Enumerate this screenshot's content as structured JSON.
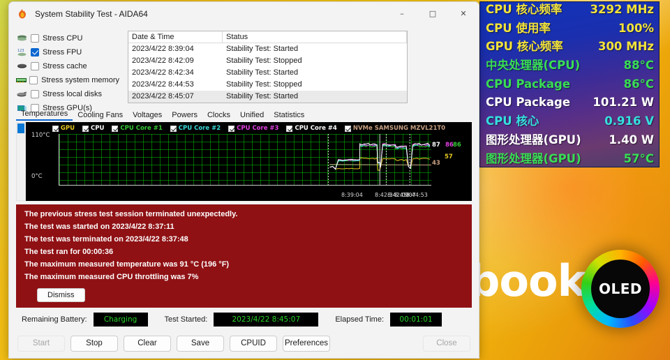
{
  "window": {
    "title": "System Stability Test - AIDA64",
    "app_icon": "flame-icon",
    "minimize": "–",
    "maximize": "□",
    "close": "✕"
  },
  "stress_options": [
    {
      "label": "Stress CPU",
      "checked": false,
      "icon": "cpu-chip-icon"
    },
    {
      "label": "Stress FPU",
      "checked": true,
      "icon": "fpu-chip-icon"
    },
    {
      "label": "Stress cache",
      "checked": false,
      "icon": "cache-chip-icon"
    },
    {
      "label": "Stress system memory",
      "checked": false,
      "icon": "memory-module-icon"
    },
    {
      "label": "Stress local disks",
      "checked": false,
      "icon": "hard-disk-icon"
    },
    {
      "label": "Stress GPU(s)",
      "checked": false,
      "icon": "gpu-card-icon"
    }
  ],
  "log": {
    "columns": [
      "Date & Time",
      "Status"
    ],
    "rows": [
      {
        "datetime": "2023/4/22 8:39:04",
        "status": "Stability Test: Started"
      },
      {
        "datetime": "2023/4/22 8:42:09",
        "status": "Stability Test: Stopped"
      },
      {
        "datetime": "2023/4/22 8:42:34",
        "status": "Stability Test: Started"
      },
      {
        "datetime": "2023/4/22 8:44:53",
        "status": "Stability Test: Stopped"
      },
      {
        "datetime": "2023/4/22 8:45:07",
        "status": "Stability Test: Started"
      }
    ]
  },
  "tabs": [
    {
      "label": "Temperatures",
      "active": true
    },
    {
      "label": "Cooling Fans",
      "active": false
    },
    {
      "label": "Voltages",
      "active": false
    },
    {
      "label": "Powers",
      "active": false
    },
    {
      "label": "Clocks",
      "active": false
    },
    {
      "label": "Unified",
      "active": false
    },
    {
      "label": "Statistics",
      "active": false
    }
  ],
  "chart_data": {
    "type": "line",
    "title": "Temperatures",
    "xlabel": "",
    "ylabel": "°C",
    "ylim": [
      0,
      110
    ],
    "ytick_labels": [
      "110°C",
      "0°C"
    ],
    "grid": true,
    "legend_position": "top",
    "x_tick_labels": [
      "8:39:04",
      "8:42:34",
      "8:42:09",
      "8:45:07",
      "8:44:53"
    ],
    "series": [
      {
        "name": "GPU",
        "color": "#e8c820",
        "current": 57,
        "checked": true
      },
      {
        "name": "CPU",
        "color": "#ffffff",
        "current": 87,
        "checked": true
      },
      {
        "name": "CPU Core #1",
        "color": "#35c735",
        "current": 86,
        "checked": true
      },
      {
        "name": "CPU Core #2",
        "color": "#3ad9d9",
        "current": 86,
        "checked": true
      },
      {
        "name": "CPU Core #3",
        "color": "#e040e0",
        "current": 87,
        "checked": true
      },
      {
        "name": "CPU Core #4",
        "color": "#ffffff",
        "current": 87,
        "checked": true
      },
      {
        "name": "NVMe SAMSUNG MZVL21T0",
        "color": "#c8a082",
        "current": 43,
        "checked": true
      }
    ],
    "value_labels": [
      {
        "text": "87",
        "color": "#ffffff"
      },
      {
        "text": "86",
        "color": "#e040e0"
      },
      {
        "text": "86",
        "color": "#35c735"
      },
      {
        "text": "57",
        "color": "#e8c820"
      },
      {
        "text": "43",
        "color": "#c8a082"
      }
    ]
  },
  "warning": {
    "lines": [
      "The previous stress test session terminated unexpectedly.",
      "The test was started on 2023/4/22 8:37:11",
      "The test was terminated on 2023/4/22 8:37:48",
      "The test ran for 00:00:36",
      "The maximum measured temperature was 91 °C  (196 °F)",
      "The maximum measured CPU throttling was 7%"
    ],
    "dismiss_label": "Dismiss",
    "background": "#8f1114"
  },
  "status": {
    "battery_label": "Remaining Battery:",
    "battery_value": "Charging",
    "started_label": "Test Started:",
    "started_value": "2023/4/22 8:45:07",
    "elapsed_label": "Elapsed Time:",
    "elapsed_value": "00:01:01",
    "value_color": "#28d428"
  },
  "buttons": [
    {
      "label": "Start",
      "disabled": true
    },
    {
      "label": "Stop",
      "disabled": false
    },
    {
      "label": "Clear",
      "disabled": false
    },
    {
      "label": "Save",
      "disabled": false
    },
    {
      "label": "CPUID",
      "disabled": false
    },
    {
      "label": "Preferences",
      "disabled": false
    },
    {
      "label": "Close",
      "disabled": true
    }
  ],
  "osd": {
    "rows": [
      {
        "label": "CPU 核心频率",
        "value": "3292 MHz",
        "color": "#f2e23a"
      },
      {
        "label": "CPU 使用率",
        "value": "100%",
        "color": "#f2e23a"
      },
      {
        "label": "GPU 核心频率",
        "value": "300 MHz",
        "color": "#f2e23a"
      },
      {
        "label": "中央处理器(CPU)",
        "value": "88°C",
        "color": "#39dd55"
      },
      {
        "label": "CPU Package",
        "value": "86°C",
        "color": "#39dd55"
      },
      {
        "label": "CPU Package",
        "value": "101.21 W",
        "color": "#ffffff"
      },
      {
        "label": "CPU 核心",
        "value": "0.916 V",
        "color": "#35e0e0"
      },
      {
        "label": "图形处理器(GPU)",
        "value": "1.40 W",
        "color": "#ffffff"
      },
      {
        "label": "图形处理器(GPU)",
        "value": "57°C",
        "color": "#39dd55"
      }
    ]
  },
  "wallpaper": {
    "word": "book",
    "logo_text": "OLED"
  }
}
